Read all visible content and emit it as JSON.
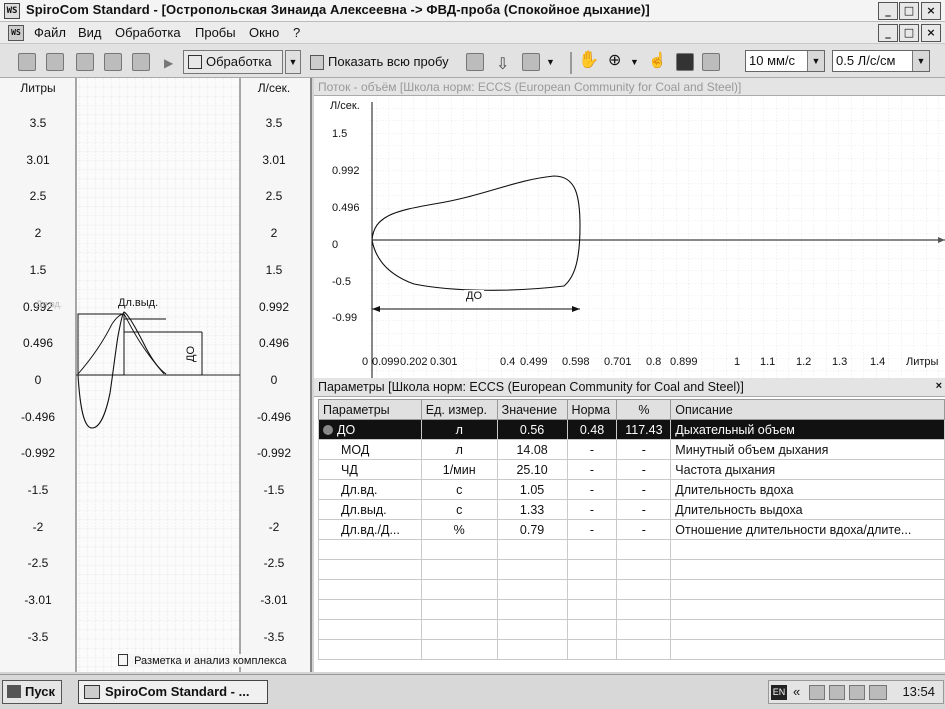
{
  "window": {
    "title": "SpiroCom Standard - [Остропольская Зинаида Алексеевна -> ФВД-проба (Спокойное дыхание)]",
    "app_icon": "WS",
    "mdi_icon": "WS"
  },
  "menu": {
    "items": [
      "Файл",
      "Вид",
      "Обработка",
      "Пробы",
      "Окно",
      "?"
    ]
  },
  "toolbar": {
    "process_label": "Обработка",
    "show_sample_label": "Показать всю пробу",
    "speed_value": "10 мм/с",
    "flow_scale_value": "0.5 Л/с/см"
  },
  "left_panel": {
    "left_axis_title": "Литры",
    "right_axis_title": "Л/сек.",
    "ticks": [
      "3.5",
      "3.01",
      "2.5",
      "2",
      "1.5",
      "0.992",
      "0.496",
      "0",
      "-0.496",
      "-0.992",
      "-1.5",
      "-2",
      "-2.5",
      "-3.01",
      "-3.5"
    ],
    "label_vyd": "Дл.выд.",
    "label_do": "ДО",
    "label_vvd_faint": "Дл.вд.",
    "footer_label": "Разметка и анализ комплекса"
  },
  "graph": {
    "header": "Поток - объём   [Школа норм: ECCS (European Community for Coal and Steel)]",
    "y_title": "Л/сек.",
    "y_ticks": [
      "1.5",
      "0.992",
      "0.496",
      "0",
      "-0.5",
      "-0.99"
    ],
    "x_ticks": [
      "0",
      "0.099",
      "0.202",
      "0.301",
      "0.4",
      "0.499",
      "0.598",
      "0.701",
      "0.8",
      "0.899",
      "1",
      "1.1",
      "1.2",
      "1.3",
      "1.4"
    ],
    "x_title": "Литры",
    "do_label": "ДО"
  },
  "params": {
    "header": "Параметры   [Школа норм: ECCS (European Community for Coal and Steel)]",
    "columns": [
      "Параметры",
      "Ед. измер.",
      "Значение",
      "Норма",
      "%",
      "Описание"
    ],
    "rows": [
      {
        "name": "ДО",
        "unit": "л",
        "value": "0.56",
        "norm": "0.48",
        "pct": "117.43",
        "desc": "Дыхательный объем"
      },
      {
        "name": "МОД",
        "unit": "л",
        "value": "14.08",
        "norm": "-",
        "pct": "-",
        "desc": "Минутный объем дыхания"
      },
      {
        "name": "ЧД",
        "unit": "1/мин",
        "value": "25.10",
        "norm": "-",
        "pct": "-",
        "desc": "Частота дыхания"
      },
      {
        "name": "Дл.вд.",
        "unit": "с",
        "value": "1.05",
        "norm": "-",
        "pct": "-",
        "desc": "Длительность вдоха"
      },
      {
        "name": "Дл.выд.",
        "unit": "с",
        "value": "1.33",
        "norm": "-",
        "pct": "-",
        "desc": "Длительность выдоха"
      },
      {
        "name": "Дл.вд./Д...",
        "unit": "%",
        "value": "0.79",
        "norm": "-",
        "pct": "-",
        "desc": "Отношение длительности вдоха/длите..."
      }
    ]
  },
  "taskbar": {
    "start_label": "Пуск",
    "task_label": "SpiroCom Standard - ...",
    "lang": "EN",
    "clock": "13:54"
  }
}
